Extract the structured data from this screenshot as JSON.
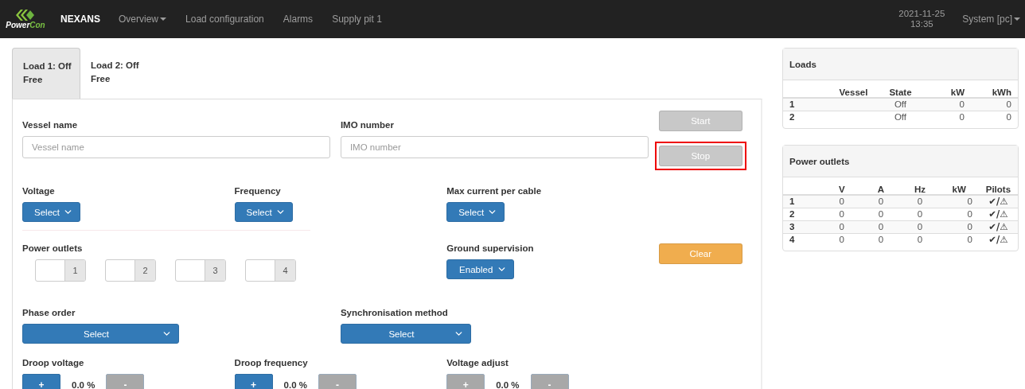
{
  "navbar": {
    "logo": {
      "word1": "Power",
      "word2": "Con"
    },
    "brand": "NEXANS",
    "items": [
      {
        "label": "Overview",
        "dropdown": true
      },
      {
        "label": "Load configuration",
        "dropdown": false
      },
      {
        "label": "Alarms",
        "dropdown": false
      },
      {
        "label": "Supply pit 1",
        "dropdown": false
      }
    ],
    "date": "2021-11-25",
    "time": "13:35",
    "user": {
      "label": "System [pc]",
      "dropdown": true
    }
  },
  "tabs": [
    {
      "title": "Load 1: Off",
      "subtitle": "Free",
      "selected": true
    },
    {
      "title": "Load 2: Off",
      "subtitle": "Free",
      "selected": false
    }
  ],
  "form": {
    "vessel_name": {
      "label": "Vessel name",
      "placeholder": "Vessel name"
    },
    "imo_number": {
      "label": "IMO number",
      "placeholder": "IMO number"
    },
    "start": {
      "label": "Start",
      "disabled": true,
      "highlighted": false
    },
    "stop": {
      "label": "Stop",
      "disabled": true,
      "highlighted": true
    },
    "voltage": {
      "label": "Voltage",
      "value": "Select"
    },
    "frequency": {
      "label": "Frequency",
      "value": "Select"
    },
    "max_current": {
      "label": "Max current per cable",
      "value": "Select"
    },
    "power_outlets": {
      "label": "Power outlets",
      "outlets": [
        {
          "number": "1"
        },
        {
          "number": "2"
        },
        {
          "number": "3"
        },
        {
          "number": "4"
        }
      ]
    },
    "ground_supervision": {
      "label": "Ground supervision",
      "value": "Enabled"
    },
    "clear": {
      "label": "Clear"
    },
    "phase_order": {
      "label": "Phase order",
      "value": "Select"
    },
    "sync_method": {
      "label": "Synchronisation method",
      "value": "Select"
    },
    "steppers": [
      {
        "label": "Droop voltage",
        "plus": "+",
        "minus": "-",
        "value": "0.0 %",
        "plus_disabled": false,
        "minus_disabled": true
      },
      {
        "label": "Droop frequency",
        "plus": "+",
        "minus": "-",
        "value": "0.0 %",
        "plus_disabled": false,
        "minus_disabled": true
      },
      {
        "label": "Voltage adjust",
        "plus": "+",
        "minus": "-",
        "value": "0.0 %",
        "plus_disabled": true,
        "minus_disabled": true
      }
    ]
  },
  "loads": {
    "title": "Loads",
    "columns": [
      "Vessel",
      "State",
      "kW",
      "kWh"
    ],
    "rows": [
      {
        "number": "1",
        "state": "Off",
        "kw": "0",
        "kwh": "0"
      },
      {
        "number": "2",
        "state": "Off",
        "kw": "0",
        "kwh": "0"
      }
    ]
  },
  "power_outlets_table": {
    "title": "Power outlets",
    "columns": [
      "V",
      "A",
      "Hz",
      "kW",
      "Pilots"
    ],
    "rows": [
      {
        "number": "1",
        "v": "0",
        "a": "0",
        "hz": "0",
        "kw": "0",
        "pilots": "✔/⚠"
      },
      {
        "number": "2",
        "v": "0",
        "a": "0",
        "hz": "0",
        "kw": "0",
        "pilots": "✔/⚠"
      },
      {
        "number": "3",
        "v": "0",
        "a": "0",
        "hz": "0",
        "kw": "0",
        "pilots": "✔/⚠"
      },
      {
        "number": "4",
        "v": "0",
        "a": "0",
        "hz": "0",
        "kw": "0",
        "pilots": "✔/⚠"
      }
    ]
  }
}
